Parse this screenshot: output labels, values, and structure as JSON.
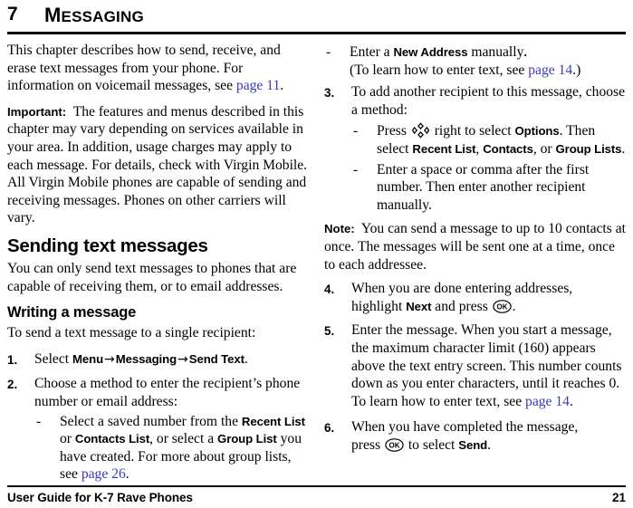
{
  "header": {
    "chapter_number": "7",
    "chapter_title_first": "M",
    "chapter_title_rest": "ESSAGING"
  },
  "footer": {
    "left": "User Guide for K-7 Rave Phones",
    "page_number": "21"
  },
  "colors": {
    "link": "#3b3bbb",
    "text": "#000000",
    "background": "#ffffff"
  },
  "left_column": {
    "intro": {
      "part1": "This chapter describes how to send, receive, and erase text messages from your phone. For information on voicemail messages, see ",
      "link": "page 11",
      "part2": "."
    },
    "important": {
      "label": "Important:",
      "text": "The features and menus described in this chapter may vary depending on services available in your area. In addition, usage charges may apply to each message. For details, check with Virgin Mobile. All Virgin Mobile phones are capable of sending and receiving messages. Phones on other carriers will vary."
    },
    "section_heading": "Sending text messages",
    "section_intro": "You can only send text messages to phones that are capable of receiving them, or to email addresses.",
    "subsection_heading": "Writing a message",
    "subsection_intro": "To send a text message to a single recipient:",
    "step1": {
      "number": "1.",
      "pre": "Select ",
      "menu1": "Menu",
      "arrow1": "→",
      "menu2": "Messaging",
      "arrow2": "→",
      "menu3": "Send Text",
      "post": "."
    },
    "step2": {
      "number": "2.",
      "text": "Choose a method to enter the recipient’s phone number or email address:",
      "dash1": {
        "mark": "-",
        "part1": "Select a saved number from the ",
        "b1": "Recent List",
        "part2": " or ",
        "b2": "Contacts List",
        "part3": ", or select a ",
        "b3": "Group List",
        "part4": " you have created. For more about group lists, see ",
        "link": "page 26",
        "part5": "."
      }
    }
  },
  "right_column": {
    "dash_new_address": {
      "mark": "-",
      "part1": "Enter a ",
      "b1": "New Address",
      "part2": " manually",
      "part3": ".",
      "line2_pre": "(To learn how to enter text, see ",
      "line2_link": "page 14",
      "line2_post": ".)"
    },
    "step3": {
      "number": "3.",
      "text": "To add another recipient to this message, choose a method:",
      "dash1": {
        "mark": "-",
        "pre": "Press ",
        "icon": "nav-key-icon",
        "mid": " right to select ",
        "b1": "Options",
        "mid2": ". Then select ",
        "b2": "Recent List",
        "sep1": ", ",
        "b3": "Contacts",
        "sep2": ", or ",
        "b4": "Group Lists",
        "post": "."
      },
      "dash2": {
        "mark": "-",
        "text": "Enter a space or comma after the first number. Then enter another recipient manually."
      }
    },
    "note": {
      "label": "Note:",
      "text": "You can send a message to up to 10 contacts at once. The messages will be sent one at a time, once to each addressee."
    },
    "step4": {
      "number": "4.",
      "pre": "When you are done entering addresses, highlight ",
      "b1": "Next",
      "mid": " and press ",
      "icon": "ok-key-icon",
      "post": "."
    },
    "step5": {
      "number": "5.",
      "pre": "Enter the message. When you start a message, the maximum character limit (160) appears above the text entry screen. This number counts down as you enter characters, until it reaches 0. To learn how to enter text, see ",
      "link": "page 14",
      "post": "."
    },
    "step6": {
      "number": "6.",
      "line1": "When you have completed the message,",
      "line2_pre": "press ",
      "icon": "ok-key-icon",
      "line2_mid": " to select ",
      "b1": "Send",
      "line2_post": "."
    }
  }
}
